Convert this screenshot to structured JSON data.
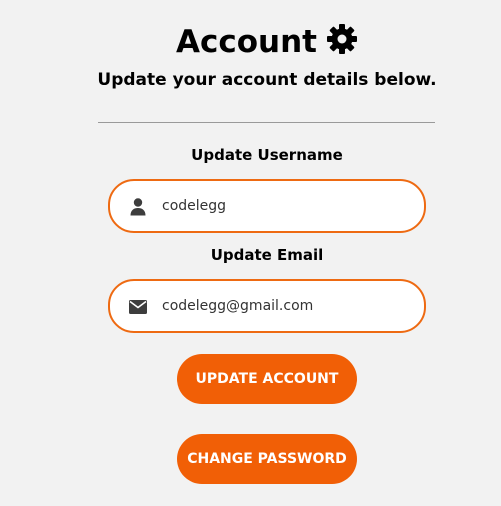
{
  "header": {
    "title": "Account",
    "title_icon": "gear-icon",
    "subtitle": "Update your account details below."
  },
  "form": {
    "username": {
      "label": "Update Username",
      "value": "codelegg",
      "icon": "user-icon"
    },
    "email": {
      "label": "Update Email",
      "value": "codelegg@gmail.com",
      "icon": "envelope-icon"
    }
  },
  "buttons": {
    "update_label": "UPDATE ACCOUNT",
    "password_label": "CHANGE PASSWORD"
  },
  "colors": {
    "accent": "#f15f06",
    "field_border": "#ee6a12",
    "background": "#f2f2f2",
    "divider": "#9a9a9a"
  }
}
